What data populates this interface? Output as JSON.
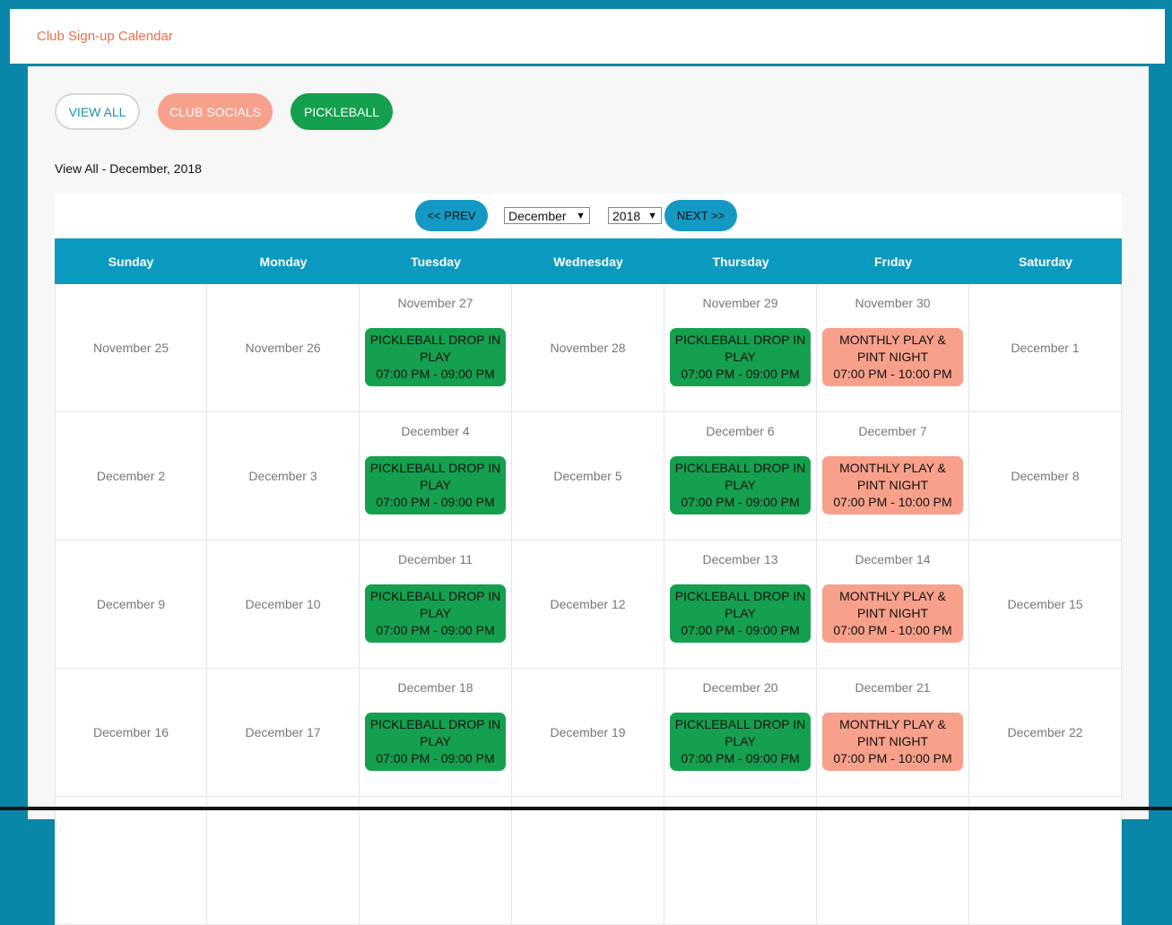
{
  "header": {
    "title": "Club Sign-up Calendar"
  },
  "filters": {
    "view_all": "VIEW ALL",
    "club_socials": "CLUB SOCIALS",
    "pickleball": "PICKLEBALL"
  },
  "subtitle": "View All - December, 2018",
  "nav": {
    "prev": "<< PREV",
    "next": "NEXT >>",
    "month": "December",
    "year": "2018"
  },
  "weekdays": [
    "Sunday",
    "Monday",
    "Tuesday",
    "Wednesday",
    "Thursday",
    "Frıday",
    "Saturday"
  ],
  "events": {
    "pickleball": {
      "line1": "PICKLEBALL DROP IN",
      "line2": "PLAY",
      "time": "07:00 PM - 09:00 PM"
    },
    "monthly": {
      "line1": "MONTHLY PLAY &",
      "line2": "PINT NIGHT",
      "time": "07:00 PM - 10:00 PM"
    }
  },
  "weeks": [
    [
      "November 25",
      "November 26",
      "November 27",
      "November 28",
      "November 29",
      "November 30",
      "December 1"
    ],
    [
      "December 2",
      "December 3",
      "December 4",
      "December 5",
      "December 6",
      "December 7",
      "December 8"
    ],
    [
      "December 9",
      "December 10",
      "December 11",
      "December 12",
      "December 13",
      "December 14",
      "December 15"
    ],
    [
      "December 16",
      "December 17",
      "December 18",
      "December 19",
      "December 20",
      "December 21",
      "December 22"
    ]
  ],
  "colors": {
    "pickleball": "#14a04e",
    "social": "#f7a08c",
    "accent": "#0a9ac0",
    "title": "#e8704a"
  }
}
